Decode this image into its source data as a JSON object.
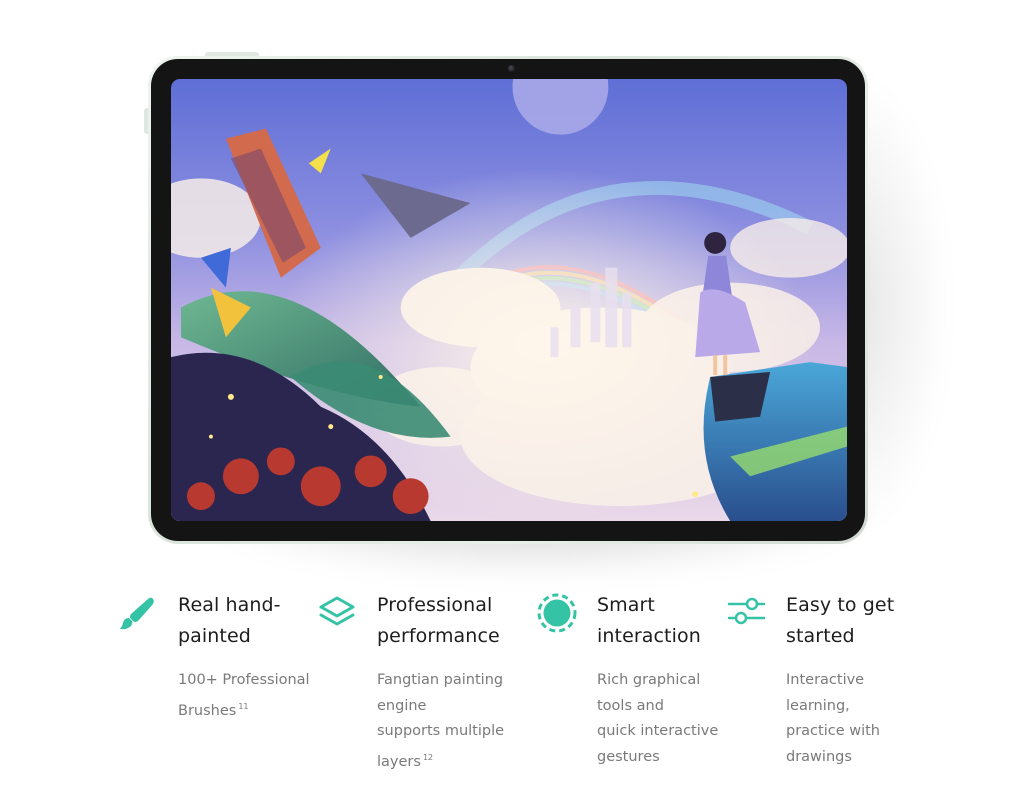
{
  "colors": {
    "accent": "#34c3a5",
    "title_text": "#1d1d1d",
    "body_text": "#7a7a7a",
    "bezel": "#141414",
    "frame": "#dfe7e1"
  },
  "device": {
    "name": "tablet",
    "screen_content": "fantasy-illustration"
  },
  "features": [
    {
      "icon": "paintbrush-icon",
      "title_lines": [
        "Real hand-",
        "painted"
      ],
      "desc_lines": [
        "100+ Professional",
        "Brushes"
      ],
      "footnote": "11"
    },
    {
      "icon": "layers-icon",
      "title_lines": [
        "Professional",
        "performance"
      ],
      "desc_lines": [
        "Fangtian painting",
        "engine",
        "supports multiple",
        "layers"
      ],
      "footnote": "12"
    },
    {
      "icon": "dashed-circle-icon",
      "title_lines": [
        "Smart",
        "interaction"
      ],
      "desc_lines": [
        "Rich graphical",
        "tools and",
        "quick interactive",
        "gestures"
      ],
      "footnote": null
    },
    {
      "icon": "sliders-icon",
      "title_lines": [
        "Easy to get",
        "started"
      ],
      "desc_lines": [
        "Interactive",
        "learning,",
        "practice with",
        "drawings"
      ],
      "footnote": null
    }
  ]
}
